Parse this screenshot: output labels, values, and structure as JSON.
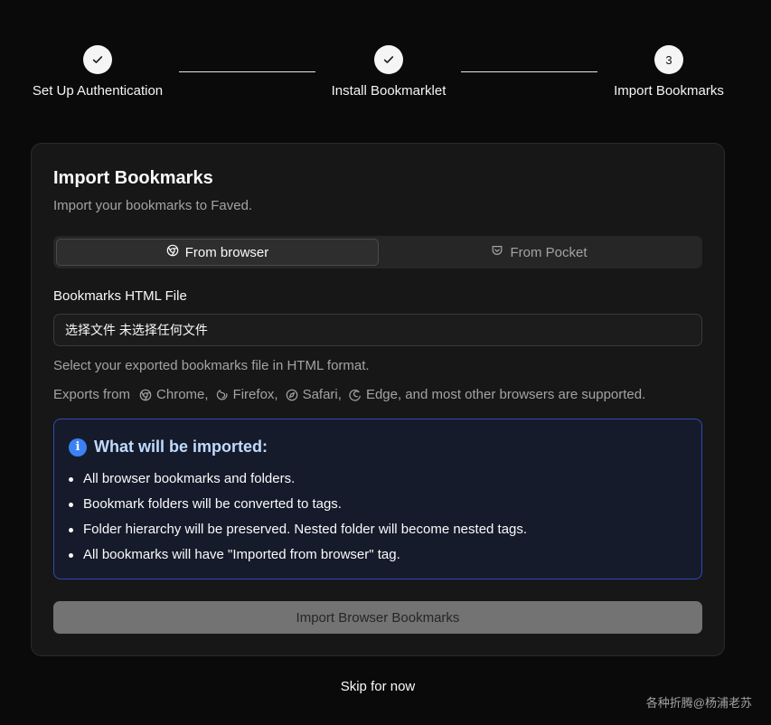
{
  "stepper": {
    "steps": [
      {
        "label": "Set Up Authentication",
        "state": "done"
      },
      {
        "label": "Install Bookmarklet",
        "state": "done"
      },
      {
        "label": "Import Bookmarks",
        "state": "current",
        "number": "3"
      }
    ]
  },
  "card": {
    "title": "Import Bookmarks",
    "description": "Import your bookmarks to Faved.",
    "tabs": [
      {
        "label": "From browser",
        "icon": "chrome-icon",
        "active": true
      },
      {
        "label": "From Pocket",
        "icon": "pocket-icon",
        "active": false
      }
    ],
    "file_field": {
      "label": "Bookmarks HTML File",
      "value": "选择文件 未选择任何文件"
    },
    "helper_text": "Select your exported bookmarks file in HTML format.",
    "exports": {
      "prefix": "Exports from",
      "browsers": [
        {
          "name": "Chrome,",
          "icon": "chrome-icon"
        },
        {
          "name": "Firefox,",
          "icon": "firefox-icon"
        },
        {
          "name": "Safari,",
          "icon": "safari-icon"
        },
        {
          "name": "Edge, and most other browsers are supported.",
          "icon": "edge-icon"
        }
      ]
    },
    "info": {
      "title": "What will be imported:",
      "items": [
        "All browser bookmarks and folders.",
        "Bookmark folders will be converted to tags.",
        "Folder hierarchy will be preserved. Nested folder will become nested tags.",
        "All bookmarks will have \"Imported from browser\" tag."
      ]
    },
    "import_button": "Import Browser Bookmarks"
  },
  "skip_label": "Skip for now",
  "watermark": "各种折腾@杨浦老苏",
  "colors": {
    "background": "#0a0a0a",
    "card": "#171717",
    "info_border": "#2f4ab8",
    "info_accent": "#3b82f6",
    "button_disabled": "#737373"
  }
}
